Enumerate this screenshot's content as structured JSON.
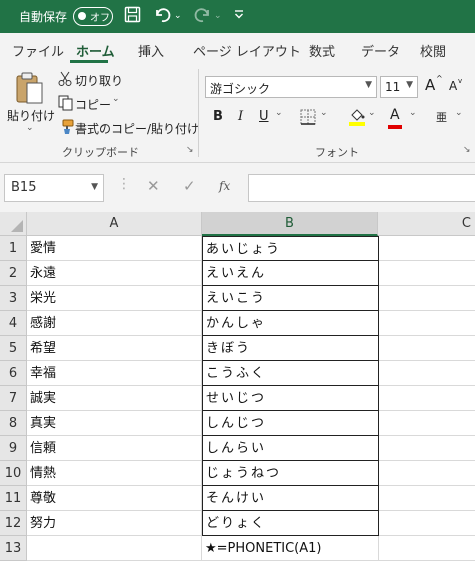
{
  "titlebar": {
    "autosave_label": "自動保存",
    "autosave_toggle": "オフ",
    "save_icon": "save-icon",
    "undo_icon": "undo-icon",
    "redo_icon": "redo-icon",
    "customize_icon": "customize-qat-icon",
    "accent_color": "#217346"
  },
  "tabs": [
    "ファイル",
    "ホーム",
    "挿入",
    "ページ レイアウト",
    "数式",
    "データ",
    "校閲"
  ],
  "active_tab": "ホーム",
  "clipboard": {
    "paste": "貼り付け",
    "cut": "切り取り",
    "copy": "コピー",
    "format_painter": "書式のコピー/貼り付け",
    "group_label": "クリップボード"
  },
  "font": {
    "family": "游ゴシック",
    "size": "11",
    "grow": "A",
    "shrink": "A",
    "bold": "B",
    "italic": "I",
    "underline": "U",
    "font_color": "A",
    "phonetic": "亜",
    "group_label": "フォント"
  },
  "formula_bar": {
    "name_box": "B15",
    "fx": "fx",
    "value": ""
  },
  "sheet": {
    "columns": [
      "A",
      "B",
      "C"
    ],
    "rows": [
      {
        "n": "1",
        "a": "愛情",
        "b": "あいじょう"
      },
      {
        "n": "2",
        "a": "永遠",
        "b": "えいえん"
      },
      {
        "n": "3",
        "a": "栄光",
        "b": "えいこう"
      },
      {
        "n": "4",
        "a": "感謝",
        "b": "かんしゃ"
      },
      {
        "n": "5",
        "a": "希望",
        "b": "きぼう"
      },
      {
        "n": "6",
        "a": "幸福",
        "b": "こうふく"
      },
      {
        "n": "7",
        "a": "誠実",
        "b": "せいじつ"
      },
      {
        "n": "8",
        "a": "真実",
        "b": "しんじつ"
      },
      {
        "n": "9",
        "a": "信頼",
        "b": "しんらい"
      },
      {
        "n": "10",
        "a": "情熱",
        "b": "じょうねつ"
      },
      {
        "n": "11",
        "a": "尊敬",
        "b": "そんけい"
      },
      {
        "n": "12",
        "a": "努力",
        "b": "どりょく"
      },
      {
        "n": "13",
        "a": "",
        "b": "★=PHONETIC(A1)"
      }
    ]
  }
}
